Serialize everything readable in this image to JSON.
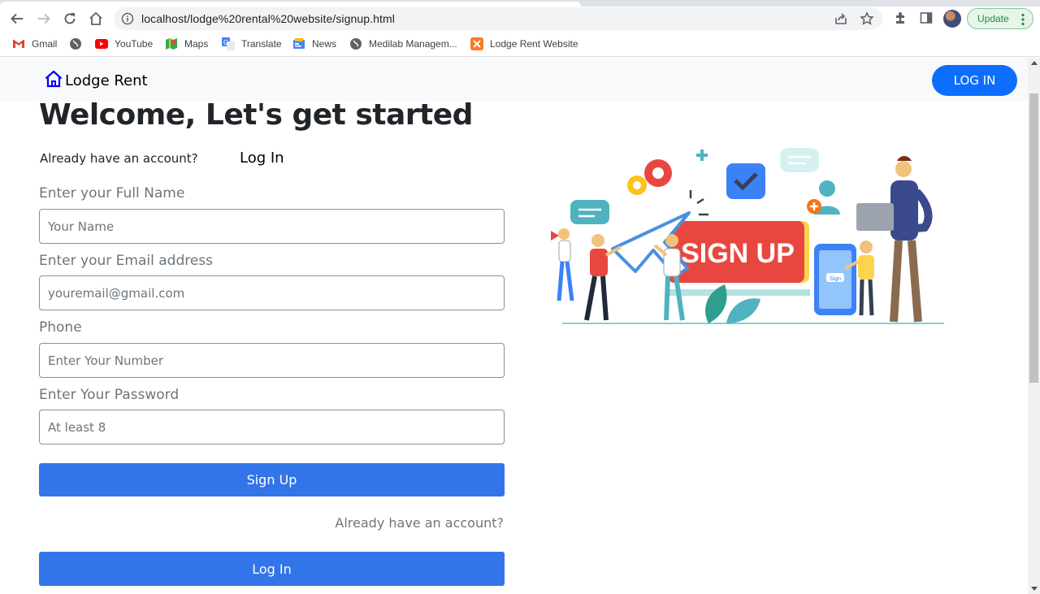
{
  "browser": {
    "url": "localhost/lodge%20rental%20website/signup.html",
    "update_label": "Update",
    "bookmarks": [
      {
        "label": "Gmail",
        "icon": "gmail-icon"
      },
      {
        "label": "",
        "icon": "globe-icon"
      },
      {
        "label": "YouTube",
        "icon": "youtube-icon"
      },
      {
        "label": "Maps",
        "icon": "maps-icon"
      },
      {
        "label": "Translate",
        "icon": "translate-icon"
      },
      {
        "label": "News",
        "icon": "news-icon"
      },
      {
        "label": "Medilab Managem...",
        "icon": "globe-icon"
      },
      {
        "label": "Lodge Rent Website",
        "icon": "xampp-icon"
      }
    ]
  },
  "navbar": {
    "brand": "Lodge Rent",
    "login_button": "LOG IN"
  },
  "page": {
    "heading": "Welcome, Let's get started",
    "already_text": "Already have an account?",
    "login_link": "Log In"
  },
  "form": {
    "name_label": "Enter your Full Name",
    "name_placeholder": "Your Name",
    "email_label": "Enter your Email address",
    "email_placeholder": "youremail@gmail.com",
    "phone_label": "Phone",
    "phone_placeholder": "Enter Your Number",
    "password_label": "Enter Your Password",
    "password_placeholder": "At least 8",
    "signup_button": "Sign Up",
    "already_text": "Already have an account?",
    "login_button": "Log In"
  },
  "illustration": {
    "banner_text": "SIGN UP",
    "phone_button_text": "Sign"
  },
  "colors": {
    "primary": "#0d6efd",
    "button_blue": "#3275e8",
    "banner_red": "#e8473f"
  }
}
